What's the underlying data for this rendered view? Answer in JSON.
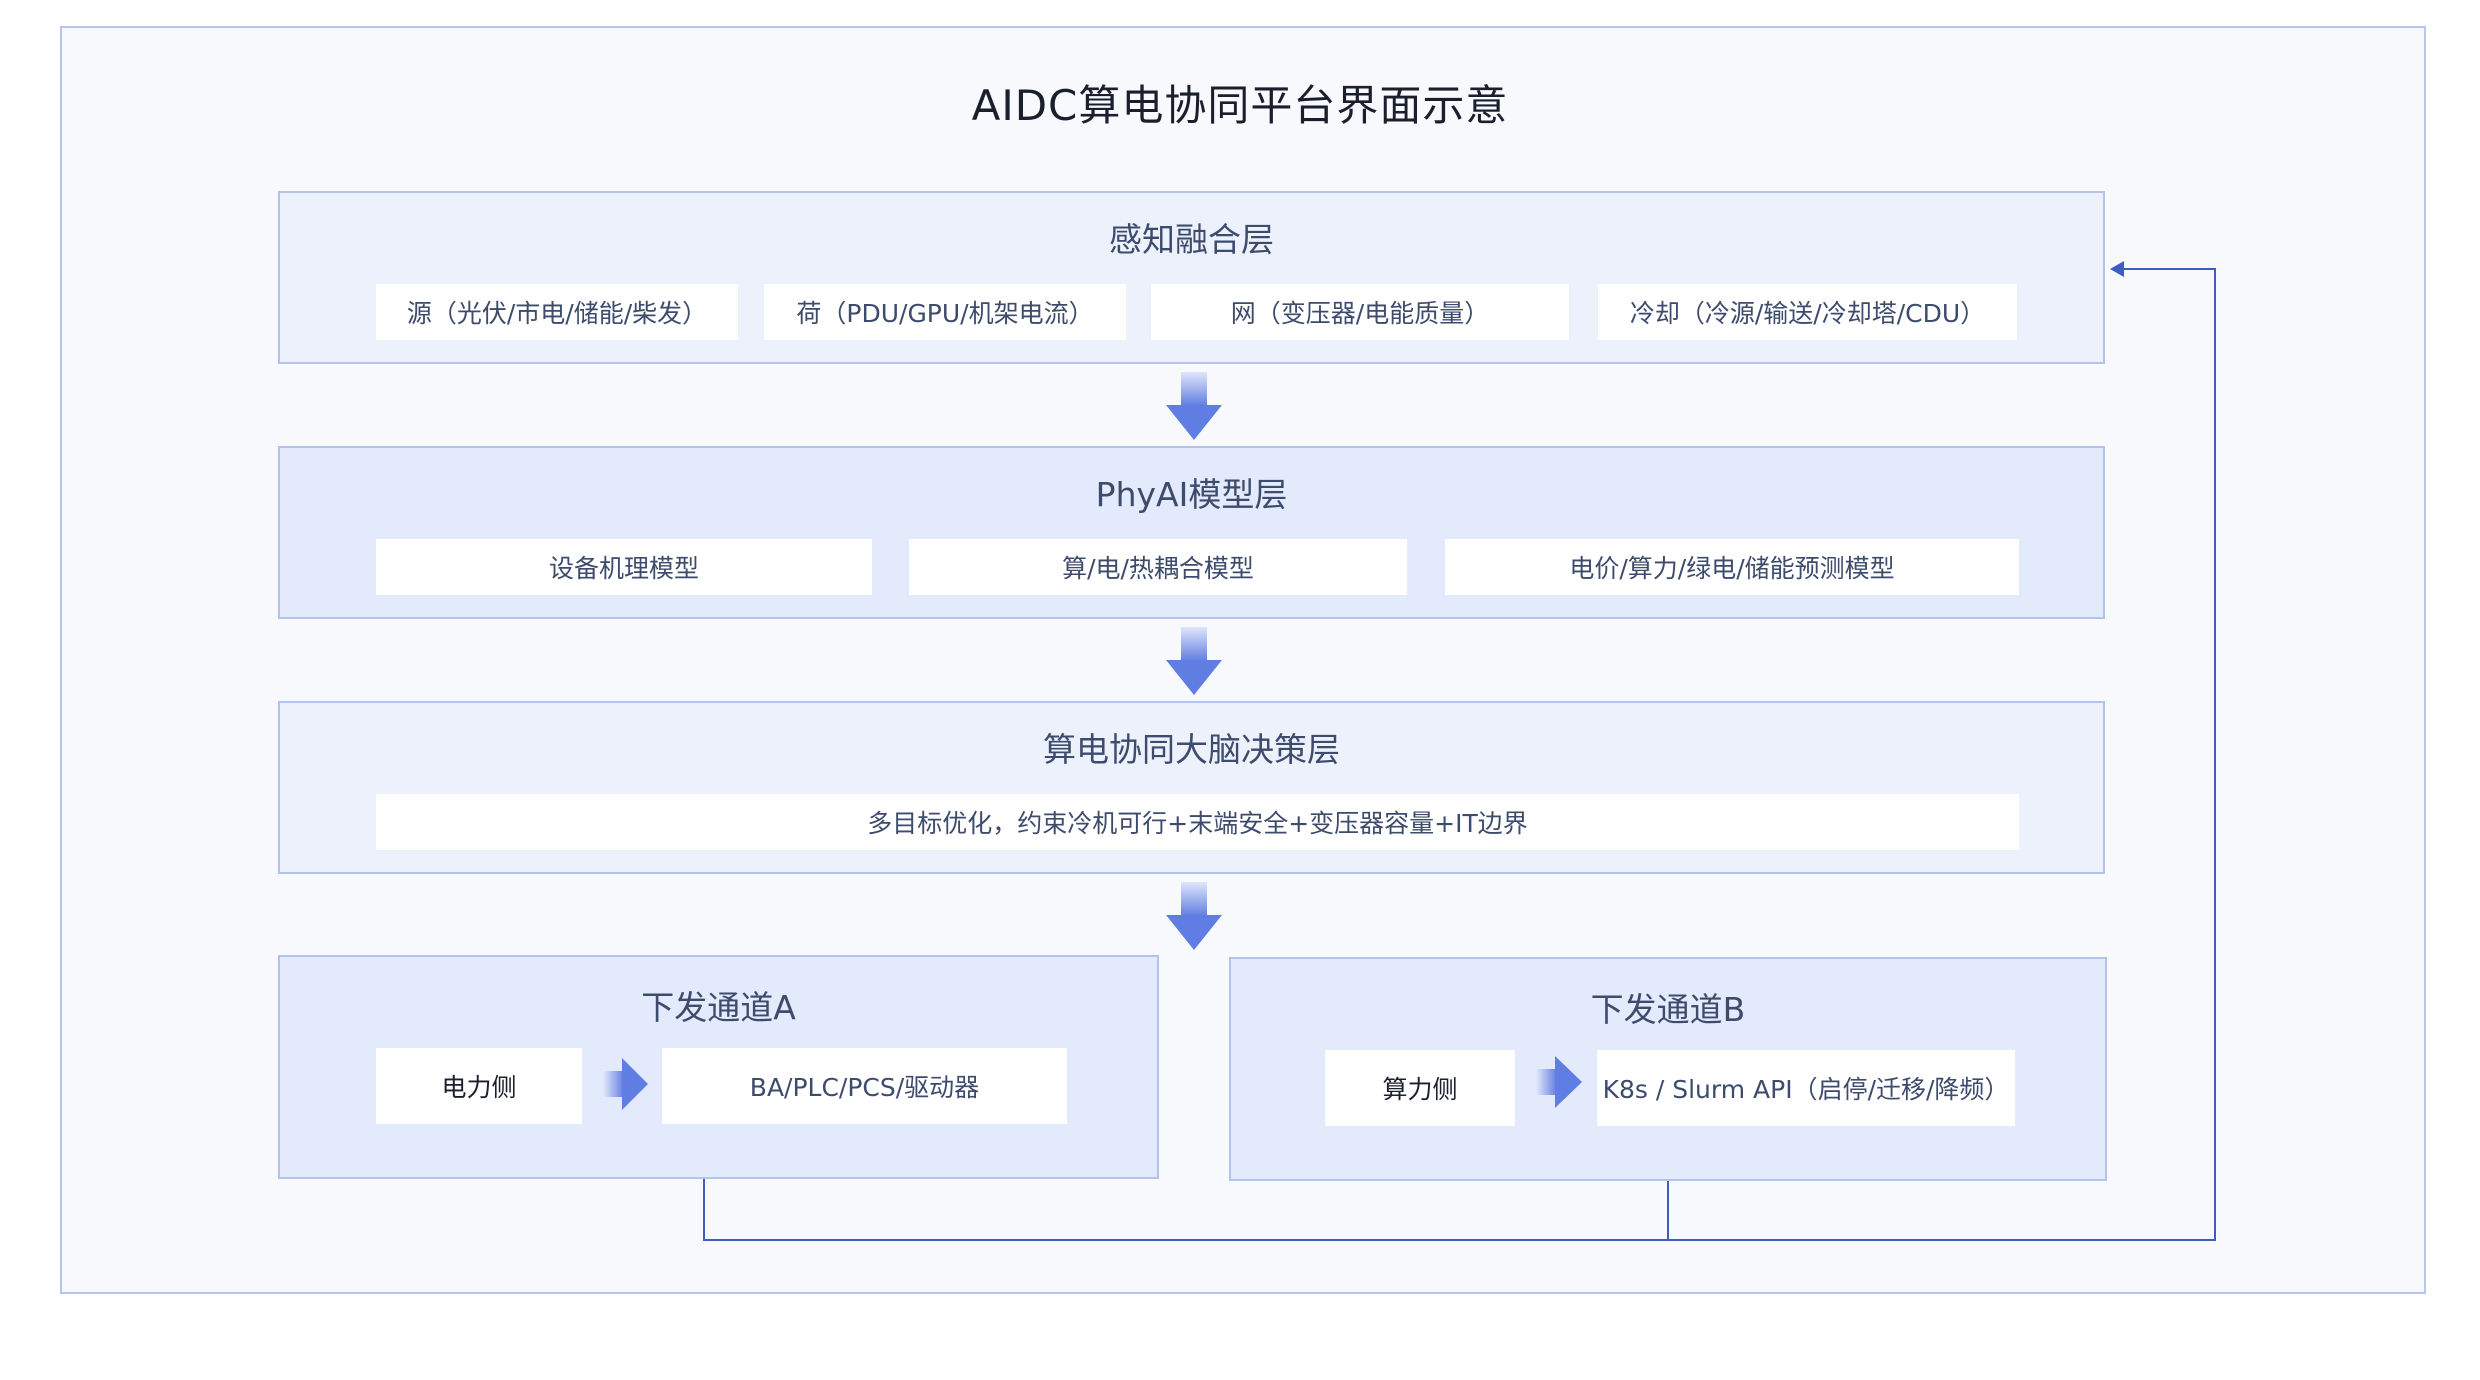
{
  "title": "AIDC算电协同平台界面示意",
  "layers": [
    {
      "title": "感知融合层",
      "items": [
        "源（光伏/市电/储能/柴发）",
        "荷（PDU/GPU/机架电流）",
        "网（变压器/电能质量）",
        "冷却（冷源/输送/冷却塔/CDU）"
      ]
    },
    {
      "title": "PhyAI模型层",
      "items": [
        "设备机理模型",
        "算/电/热耦合模型",
        "电价/算力/绿电/储能预测模型"
      ]
    },
    {
      "title": "算电协同大脑决策层",
      "items": [
        "多目标优化，约束冷机可行+末端安全+变压器容量+IT边界"
      ]
    }
  ],
  "channels": [
    {
      "title": "下发通道A",
      "side": "电力侧",
      "target": "BA/PLC/PCS/驱动器"
    },
    {
      "title": "下发通道B",
      "side": "算力侧",
      "target": "K8s / Slurm API（启停/迁移/降频）"
    }
  ],
  "colors": {
    "frame_border": "#b9c6e8",
    "layer_fill": "#ecf1fc",
    "layer_fill_dark": "#e2eafb",
    "arrow": "#5f7de3",
    "feedback_line": "#3f5bc4"
  }
}
